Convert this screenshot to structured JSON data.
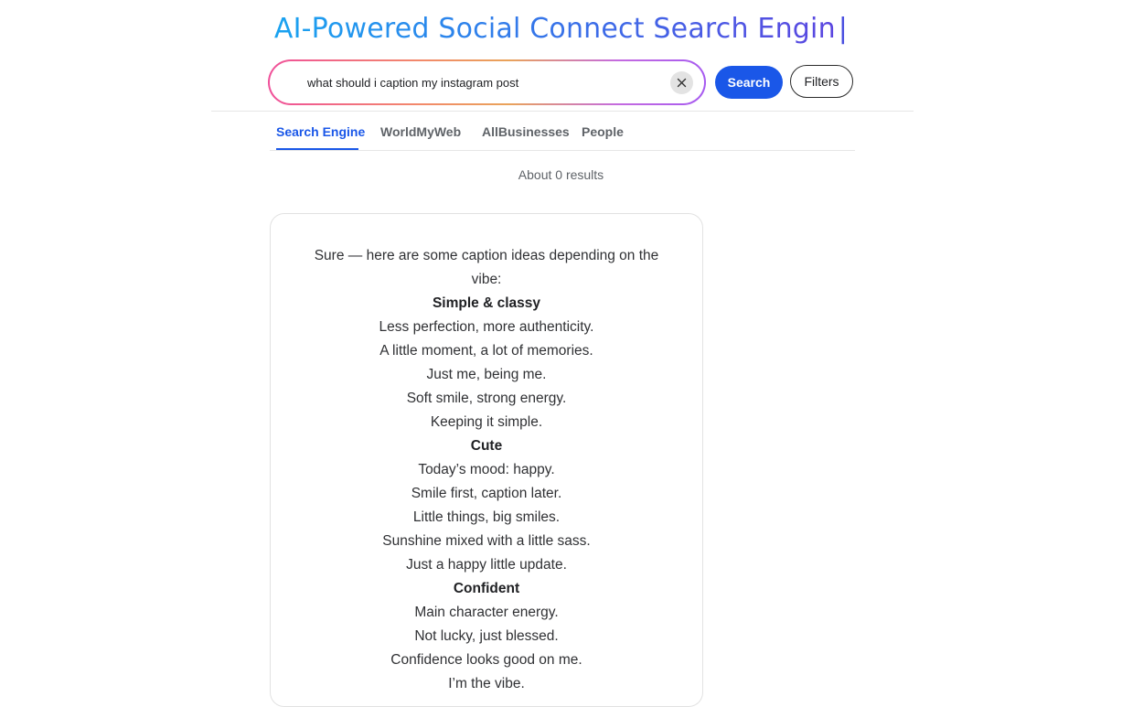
{
  "header": {
    "title": "AI-Powered Social Connect Search Engin",
    "cursor": "|"
  },
  "search": {
    "query": "what should i caption my instagram post",
    "search_label": "Search",
    "filters_label": "Filters",
    "gradient_colors": [
      "#f0509a",
      "#e9a35a",
      "#a65af0"
    ]
  },
  "tabs": [
    {
      "label": "Search Engine",
      "active": true
    },
    {
      "label": "WorldMyWeb",
      "active": false
    },
    {
      "label": "AllBusinesses",
      "active": false
    },
    {
      "label": "People",
      "active": false
    }
  ],
  "results": {
    "count_text": "About 0 results"
  },
  "answer": {
    "intro": "Sure — here are some caption ideas depending on the vibe:",
    "sections": [
      {
        "heading": "Simple & classy",
        "items": [
          "Less perfection, more authenticity.",
          "A little moment, a lot of memories.",
          "Just me, being me.",
          "Soft smile, strong energy.",
          "Keeping it simple."
        ]
      },
      {
        "heading": "Cute",
        "items": [
          "Today’s mood: happy.",
          "Smile first, caption later.",
          "Little things, big smiles.",
          "Sunshine mixed with a little sass.",
          "Just a happy little update."
        ]
      },
      {
        "heading": "Confident",
        "items": [
          "Main character energy.",
          "Not lucky, just blessed.",
          "Confidence looks good on me.",
          "I’m the vibe."
        ]
      }
    ]
  },
  "colors": {
    "accent": "#1a57e8",
    "title_gradient_start": "#1aa3f0",
    "title_gradient_end": "#5b46e0"
  }
}
